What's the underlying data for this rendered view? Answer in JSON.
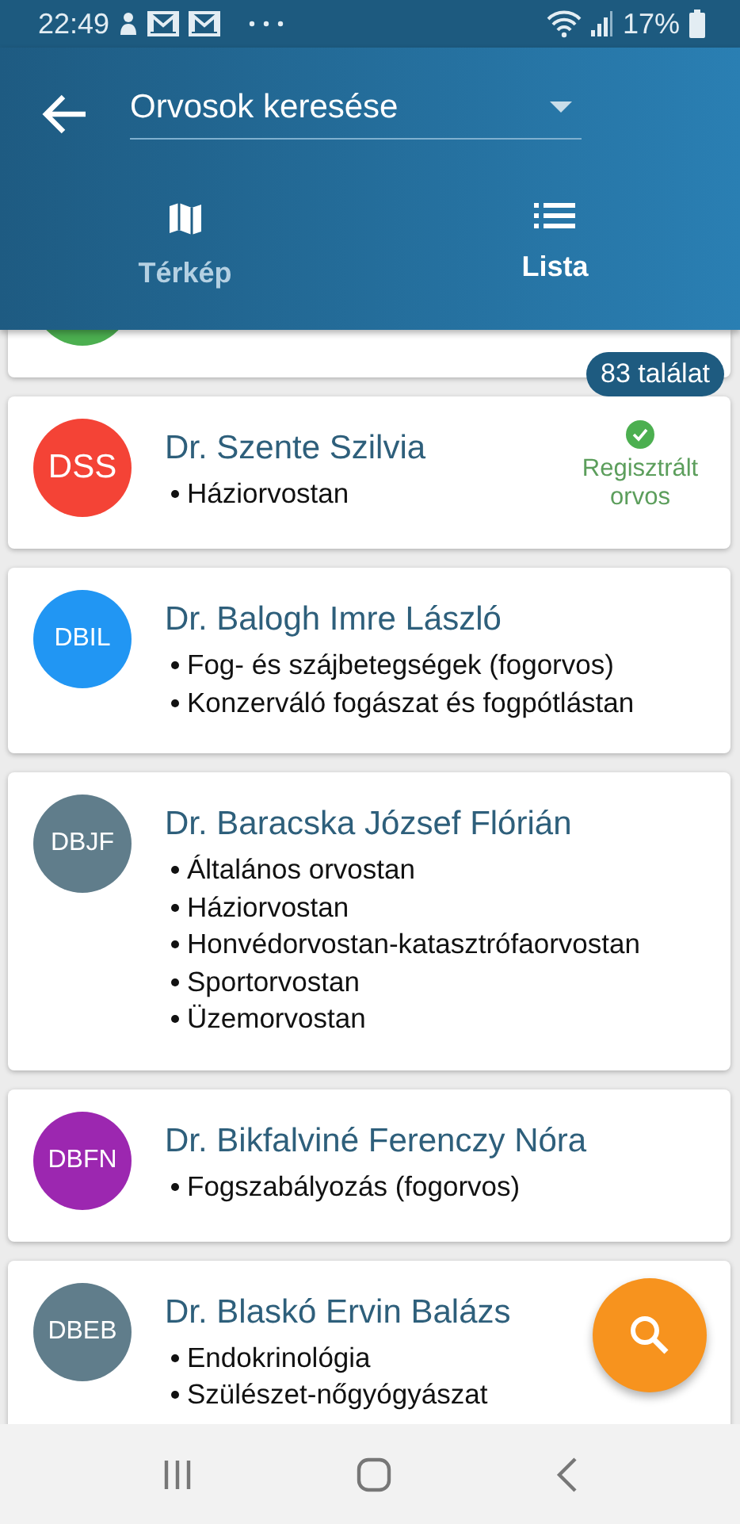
{
  "status_bar": {
    "time": "22:49",
    "battery": "17%"
  },
  "header": {
    "title": "Orvosok keresése"
  },
  "tabs": [
    {
      "label": "Térkép",
      "kind": "map",
      "selected": false
    },
    {
      "label": "Lista",
      "kind": "list",
      "selected": true
    }
  ],
  "result_count": "83 találat",
  "doctors": [
    {
      "partial": true,
      "color": "#4caf50"
    },
    {
      "initials": "DSS",
      "name": "Dr. Szente Szilvia",
      "color": "#f44336",
      "specialties": [
        "Háziorvostan"
      ],
      "registered_label": "Regisztrált orvos"
    },
    {
      "initials": "DBIL",
      "name": "Dr. Balogh Imre László",
      "color": "#2196f3",
      "specialties": [
        "Fog- és szájbetegségek (fogorvos)",
        "Konzerváló fogászat és fogpótlástan"
      ]
    },
    {
      "initials": "DBJF",
      "name": "Dr. Baracska József Flórián",
      "color": "#607d8b",
      "specialties": [
        "Általános orvostan",
        "Háziorvostan",
        "Honvédorvostan-katasztrófaorvostan",
        "Sportorvostan",
        "Üzemorvostan"
      ]
    },
    {
      "initials": "DBFN",
      "name": "Dr. Bikfalviné Ferenczy Nóra",
      "color": "#9c27b0",
      "specialties": [
        "Fogszabályozás (fogorvos)"
      ]
    },
    {
      "initials": "DBEB",
      "name": "Dr. Blaskó Ervin Balázs",
      "color": "#607d8b",
      "specialties": [
        "Endokrinológia",
        "Szülészet-nőgyógyászat"
      ]
    }
  ]
}
